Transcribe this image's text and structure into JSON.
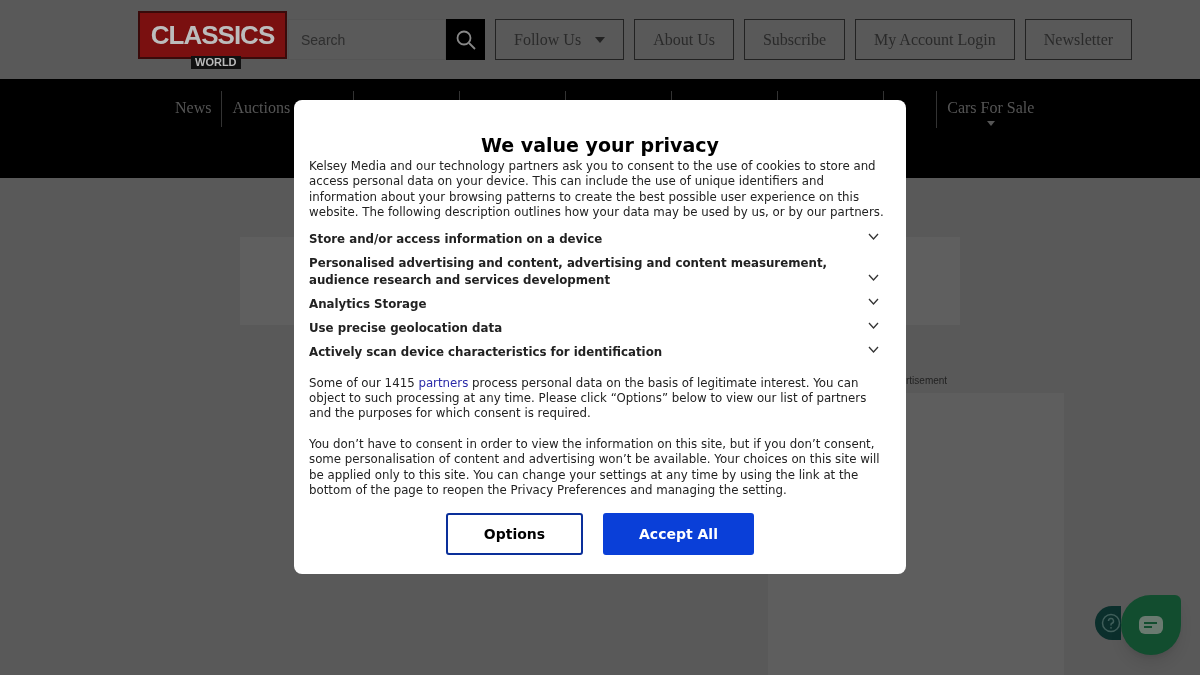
{
  "header": {
    "logo": {
      "main": "CLASSICS",
      "sub": "WORLD"
    },
    "search": {
      "placeholder": "Search"
    },
    "buttons": [
      {
        "label": "Follow Us",
        "dropdown": true
      },
      {
        "label": "About Us",
        "dropdown": false
      },
      {
        "label": "Subscribe",
        "dropdown": false
      },
      {
        "label": "My Account Login",
        "dropdown": false
      },
      {
        "label": "Newsletter",
        "dropdown": false
      }
    ]
  },
  "nav": {
    "items": [
      {
        "label": "News",
        "dropdown": false
      },
      {
        "label": "Auctions",
        "dropdown": false
      },
      {
        "label": "Cars For Sale",
        "dropdown": true
      }
    ]
  },
  "advert_label": "rtisement",
  "consent_dialog": {
    "title": "We value your privacy",
    "intro": "Kelsey Media and our technology partners ask you to consent to the use of cookies to store and access personal data on your device. This can include the use of unique identifiers and information about your browsing patterns to create the best possible user experience on this website. The following description outlines how your data may be used by us, or by our partners.",
    "purposes": [
      {
        "label": "Store and/or access information on a device",
        "expanded": false
      },
      {
        "label": "Personalised advertising and content, advertising and content measurement, audience research and services development",
        "expanded": false
      },
      {
        "label": "Analytics Storage",
        "expanded": false
      },
      {
        "label": "Use precise geolocation data",
        "expanded": false
      },
      {
        "label": "Actively scan device characteristics for identification",
        "expanded": false
      }
    ],
    "legit_before": "Some of our 1415 ",
    "legit_link": "partners",
    "legit_after": " process personal data on the basis of legitimate interest. You can object to such processing at any time. Please click “Options” below to view our list of partners and the purposes for which consent is required.",
    "notice": "You don’t have to consent in order to view the information on this site, but if you don’t consent, some personalisation of content and advertising won’t be available. Your choices on this site will be applied only to this site. You can change your settings at any time by using the link at the bottom of the page to reopen the Privacy Preferences and managing the setting.",
    "buttons": [
      {
        "label": "Options",
        "kind": "secondary"
      },
      {
        "label": "Accept All",
        "kind": "primary"
      }
    ]
  }
}
